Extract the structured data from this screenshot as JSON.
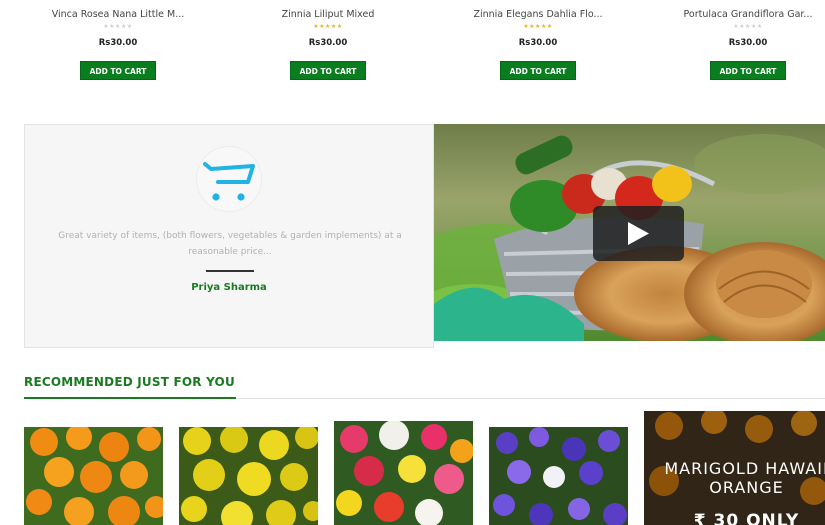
{
  "products": [
    {
      "name": "Vinca Rosea Nana Little M...",
      "rating": 0,
      "price": "Rs30.00",
      "button": "ADD TO CART"
    },
    {
      "name": "Zinnia Liliput Mixed",
      "rating": 5,
      "price": "Rs30.00",
      "button": "ADD TO CART"
    },
    {
      "name": "Zinnia Elegans Dahlia Flo...",
      "rating": 5,
      "price": "Rs30.00",
      "button": "ADD TO CART"
    },
    {
      "name": "Portulaca Grandiflora Gar...",
      "rating": 0,
      "price": "Rs30.00",
      "button": "ADD TO CART"
    }
  ],
  "testimonial": {
    "quote": "Great variety of items, (both flowers, vegetables & garden implements) at a reasonable price...",
    "author": "Priya Sharma",
    "logo_icon": "shopping-cart-icon",
    "accent": "#21b3e6"
  },
  "video": {
    "play_icon": "play-icon"
  },
  "recommended": {
    "title": "RECOMMENDED JUST FOR YOU",
    "promo_text": "MARIGOLD HAWAII ORANGE",
    "promo_price": "₹ 30 ONLY"
  },
  "colors": {
    "brand_green": "#0a7d1e",
    "star_on": "#f4b400",
    "star_off": "#d0d0d0"
  }
}
